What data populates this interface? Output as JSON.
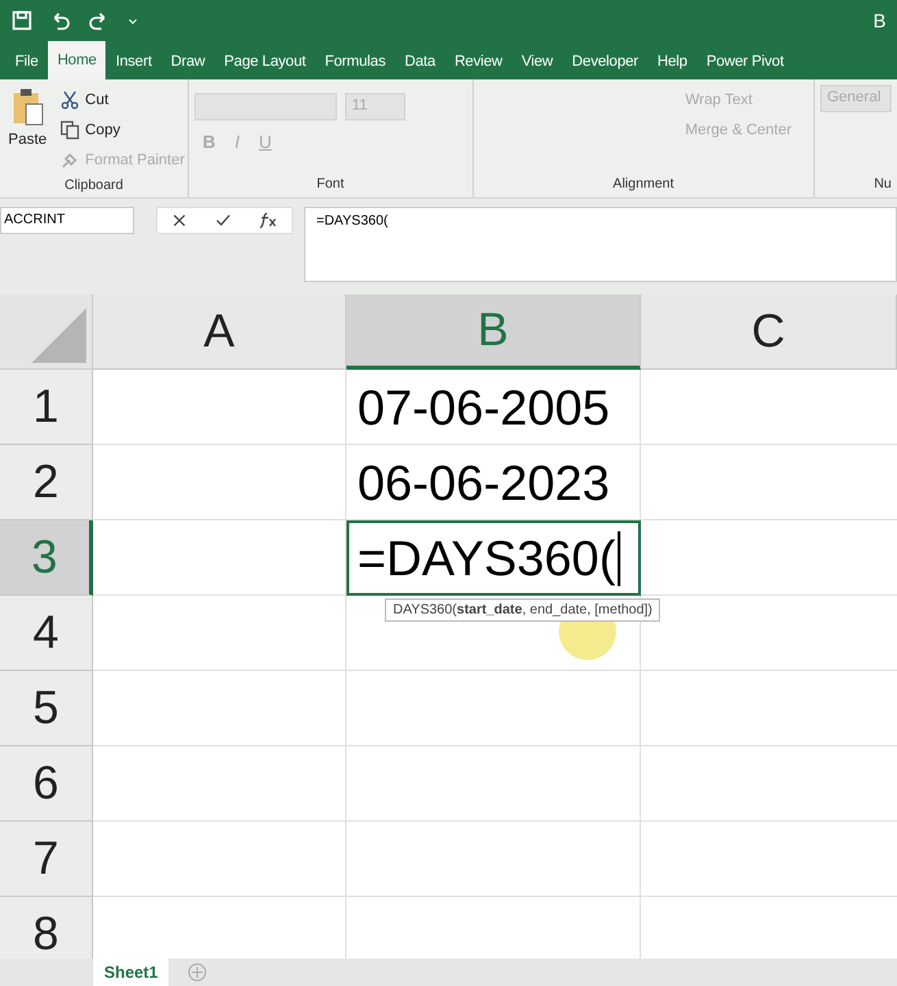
{
  "title": "B",
  "menu_tabs": [
    {
      "label": "File",
      "selected": false
    },
    {
      "label": "Home",
      "selected": true
    },
    {
      "label": "Insert",
      "selected": false
    },
    {
      "label": "Draw",
      "selected": false
    },
    {
      "label": "Page Layout",
      "selected": false
    },
    {
      "label": "Formulas",
      "selected": false
    },
    {
      "label": "Data",
      "selected": false
    },
    {
      "label": "Review",
      "selected": false
    },
    {
      "label": "View",
      "selected": false
    },
    {
      "label": "Developer",
      "selected": false
    },
    {
      "label": "Help",
      "selected": false
    },
    {
      "label": "Power Pivot",
      "selected": false
    }
  ],
  "clipboard": {
    "label": "Clipboard",
    "paste": "Paste",
    "cut": "Cut",
    "copy": "Copy",
    "format_painter": "Format Painter"
  },
  "font": {
    "label": "Font",
    "size": "11",
    "style_buttons": [
      {
        "kind": "bold",
        "label": "B"
      },
      {
        "kind": "italic",
        "label": "I"
      },
      {
        "kind": "underline",
        "label": "U"
      }
    ]
  },
  "alignment": {
    "label": "Alignment",
    "wrap_text": "Wrap Text",
    "merge_center": "Merge & Center"
  },
  "number": {
    "format": "General",
    "label": "Nu"
  },
  "name_box": "ACCRINT",
  "formula": "=DAYS360(",
  "columns": [
    {
      "label": "A",
      "selected": false
    },
    {
      "label": "B",
      "selected": true
    },
    {
      "label": "C",
      "selected": false
    }
  ],
  "rows": [
    {
      "label": "1",
      "selected": false,
      "value_b": "07-06-2005"
    },
    {
      "label": "2",
      "selected": false,
      "value_b": "06-06-2023"
    },
    {
      "label": "3",
      "selected": true,
      "value_b": "=DAYS360(",
      "editing": true
    },
    {
      "label": "4",
      "selected": false
    },
    {
      "label": "5",
      "selected": false
    },
    {
      "label": "6",
      "selected": false
    },
    {
      "label": "7",
      "selected": false
    },
    {
      "label": "8",
      "selected": false
    }
  ],
  "tooltip": "DAYS360(**start_date**, end_date, [method])",
  "sheets": [
    {
      "label": "Sheet1",
      "selected": true
    }
  ]
}
